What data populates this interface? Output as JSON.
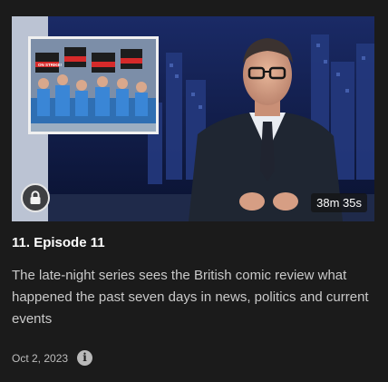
{
  "episode": {
    "title": "11. Episode 11",
    "description": "The late-night series sees the British comic review what happened the past seven days in news, politics and current events",
    "air_date": "Oct 2, 2023",
    "duration": "38m 35s",
    "locked": true,
    "inset_sign_text": "ON STRIKE!"
  },
  "icons": {
    "lock": "lock-icon",
    "info": "info-icon",
    "info_glyph": "i"
  },
  "colors": {
    "background": "#1b1b1b",
    "title_text": "#ffffff",
    "description_text": "#c9c9c9",
    "meta_text": "#bdbdbd"
  }
}
